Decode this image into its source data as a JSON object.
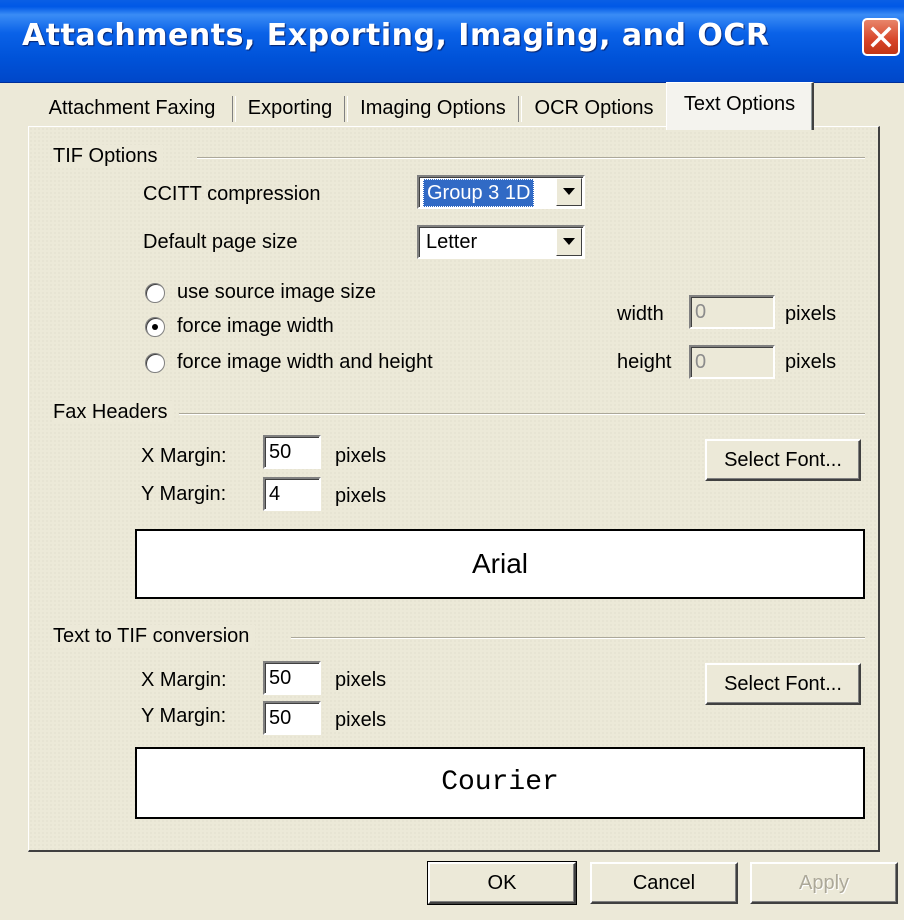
{
  "window": {
    "title": "Attachments, Exporting, Imaging, and OCR"
  },
  "tabs": [
    {
      "label": "Attachment Faxing"
    },
    {
      "label": "Exporting"
    },
    {
      "label": "Imaging Options"
    },
    {
      "label": "OCR Options"
    },
    {
      "label": "Text Options",
      "active": true
    }
  ],
  "tif_options": {
    "group_label": "TIF Options",
    "ccitt_label": "CCITT compression",
    "ccitt_value": "Group 3 1D",
    "page_size_label": "Default page size",
    "page_size_value": "Letter",
    "radios": [
      {
        "label": "use source image size",
        "checked": false
      },
      {
        "label": "force image width",
        "checked": true
      },
      {
        "label": "force image width and height",
        "checked": false
      }
    ],
    "width_label": "width",
    "width_value": "0",
    "width_unit": "pixels",
    "height_label": "height",
    "height_value": "0",
    "height_unit": "pixels"
  },
  "fax_headers": {
    "group_label": "Fax Headers",
    "x_margin_label": "X Margin:",
    "x_margin_value": "50",
    "x_unit": "pixels",
    "y_margin_label": "Y Margin:",
    "y_margin_value": "4",
    "y_unit": "pixels",
    "select_font_label": "Select Font...",
    "font_preview": "Arial"
  },
  "text_to_tif": {
    "group_label": "Text to TIF conversion",
    "x_margin_label": "X Margin:",
    "x_margin_value": "50",
    "x_unit": "pixels",
    "y_margin_label": "Y Margin:",
    "y_margin_value": "50",
    "y_unit": "pixels",
    "select_font_label": "Select Font...",
    "font_preview": "Courier"
  },
  "buttons": {
    "ok": "OK",
    "cancel": "Cancel",
    "apply": "Apply"
  },
  "colors": {
    "titlebar": "#0054e3",
    "dialog_bg": "#ece9d8",
    "selection": "#316ac5",
    "close": "#d74428"
  }
}
